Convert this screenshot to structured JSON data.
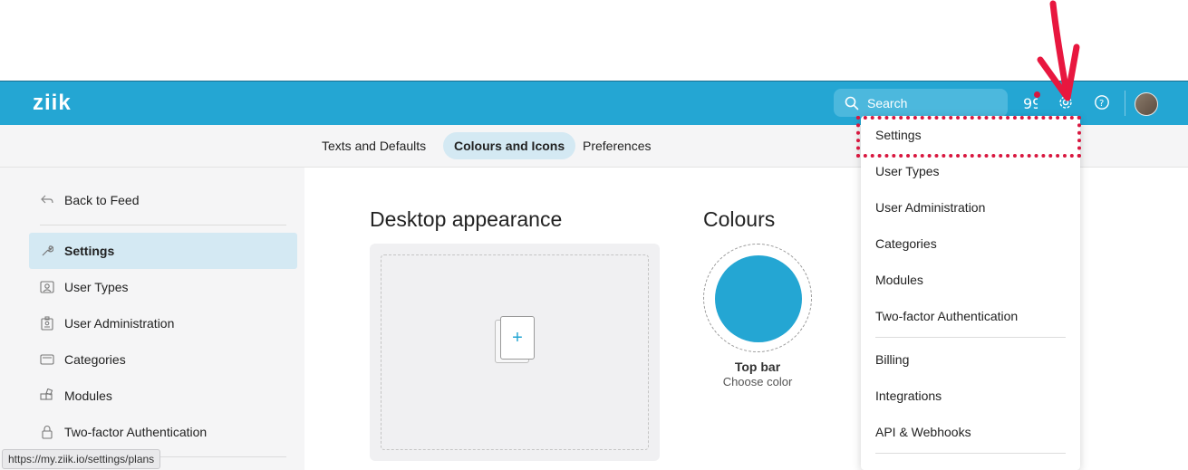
{
  "app": {
    "logo_text": "ziik"
  },
  "topbar": {
    "search_placeholder": "Search",
    "icons": [
      "search-icon",
      "quote-icon",
      "gear-icon",
      "help-icon"
    ],
    "accent_color": "#24a6d3",
    "notification_color": "#d8173f"
  },
  "tabs": [
    {
      "label": "Texts and Defaults",
      "active": false
    },
    {
      "label": "Colours and Icons",
      "active": true
    },
    {
      "label": "Preferences",
      "active": false
    }
  ],
  "sidebar": {
    "back_label": "Back to Feed",
    "items": [
      {
        "label": "Settings",
        "icon": "wrench-icon",
        "active": true
      },
      {
        "label": "User Types",
        "icon": "user-card-icon",
        "active": false
      },
      {
        "label": "User Administration",
        "icon": "id-badge-icon",
        "active": false
      },
      {
        "label": "Categories",
        "icon": "folder-icon",
        "active": false
      },
      {
        "label": "Modules",
        "icon": "blocks-icon",
        "active": false
      },
      {
        "label": "Two-factor Authentication",
        "icon": "lock-icon",
        "active": false
      }
    ]
  },
  "main": {
    "desktop_title": "Desktop appearance",
    "colours_title": "Colours",
    "topbar_label": "Top bar",
    "topbar_sub": "Choose color",
    "topbar_color": "#24a6d3"
  },
  "dropdown": {
    "items": [
      "Settings",
      "User Types",
      "User Administration",
      "Categories",
      "Modules",
      "Two-factor Authentication"
    ],
    "items2": [
      "Billing",
      "Integrations",
      "API & Webhooks"
    ],
    "highlight_color": "#d8173f"
  },
  "status_url": "https://my.ziik.io/settings/plans"
}
